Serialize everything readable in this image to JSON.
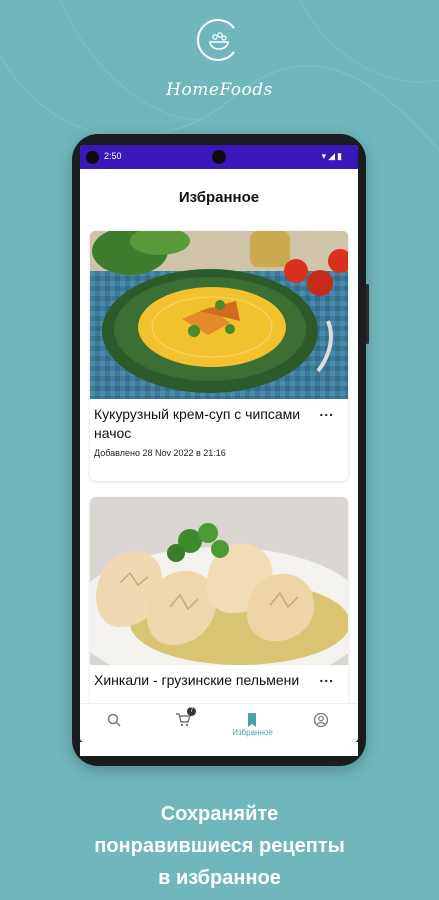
{
  "brand": {
    "name": "HomeFoods"
  },
  "status_bar": {
    "time": "2:50"
  },
  "screen": {
    "title": "Избранное"
  },
  "favorites": [
    {
      "title": "Кукурузный крем-суп с чипсами начос",
      "added": "Добавлено 28 Nov 2022 в 21:16",
      "more": "..."
    },
    {
      "title": "Хинкали - грузинские пельмени",
      "added": "",
      "more": "..."
    }
  ],
  "bottom_nav": {
    "items": [
      {
        "icon": "search-icon",
        "label": ""
      },
      {
        "icon": "cart-icon",
        "label": "",
        "badge": "7"
      },
      {
        "icon": "bookmark-icon",
        "label": "Избранное",
        "active": true
      },
      {
        "icon": "profile-icon",
        "label": ""
      }
    ]
  },
  "caption": {
    "line1": "Сохраняйте",
    "line2": "понравившиеся рецепты",
    "line3": "в избранное"
  },
  "colors": {
    "background": "#6fb7bd",
    "status_bar": "#3a17b8",
    "accent": "#46a3a9"
  }
}
